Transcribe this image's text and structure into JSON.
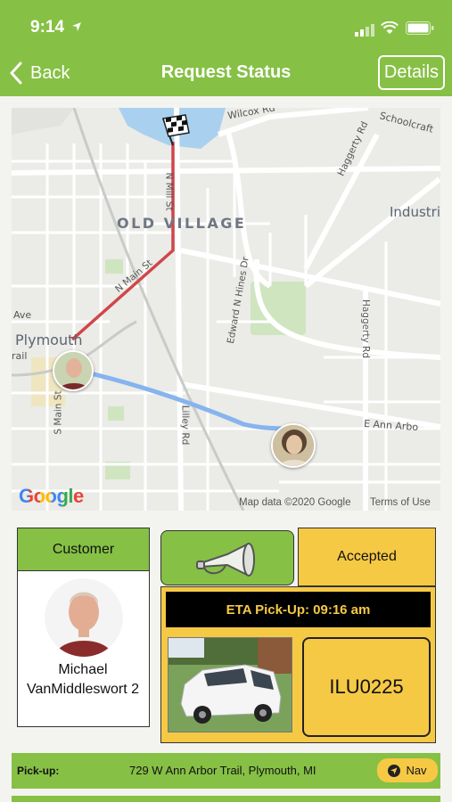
{
  "status_bar": {
    "time": "9:14"
  },
  "nav": {
    "back_label": "Back",
    "title": "Request Status",
    "details_label": "Details"
  },
  "map": {
    "labels": {
      "old_village": "OLD VILLAGE",
      "plymouth": "Plymouth",
      "industri": "Industri",
      "wilcox": "Wilcox Rd",
      "schoolcraft": "Schoolcraft",
      "haggerty_top": "Haggerty Rd",
      "haggerty_mid": "Haggerty Rd",
      "n_mill": "N Mill St",
      "n_main": "N Main St",
      "edward_hines": "Edward N Hines Dr",
      "ann_arbor": "E Ann Arbo",
      "s_main": "S Main St",
      "lilley": "Lilley Rd",
      "ave": "Ave",
      "rail": "rail"
    },
    "google": "Google",
    "map_data": "Map data ©2020 Google",
    "terms": "Terms of Use"
  },
  "customer": {
    "header": "Customer",
    "name": "Michael VanMiddleswort 2"
  },
  "request": {
    "status": "Accepted",
    "eta": "ETA Pick-Up: 09:16 am",
    "plate": "ILU0225"
  },
  "pickup": {
    "label": "Pick-up:",
    "address": "729 W Ann Arbor Trail, Plymouth, MI",
    "nav_label": "Nav"
  },
  "colors": {
    "brand_green": "#86c045",
    "accent_yellow": "#f6c945",
    "route_red": "#d0464a",
    "route_blue": "#86b4ee"
  },
  "icons": [
    "location-arrow-icon",
    "signal-icon",
    "wifi-icon",
    "battery-icon",
    "chevron-left-icon",
    "checkered-flag-icon",
    "horn-icon",
    "navigation-arrow-icon"
  ]
}
